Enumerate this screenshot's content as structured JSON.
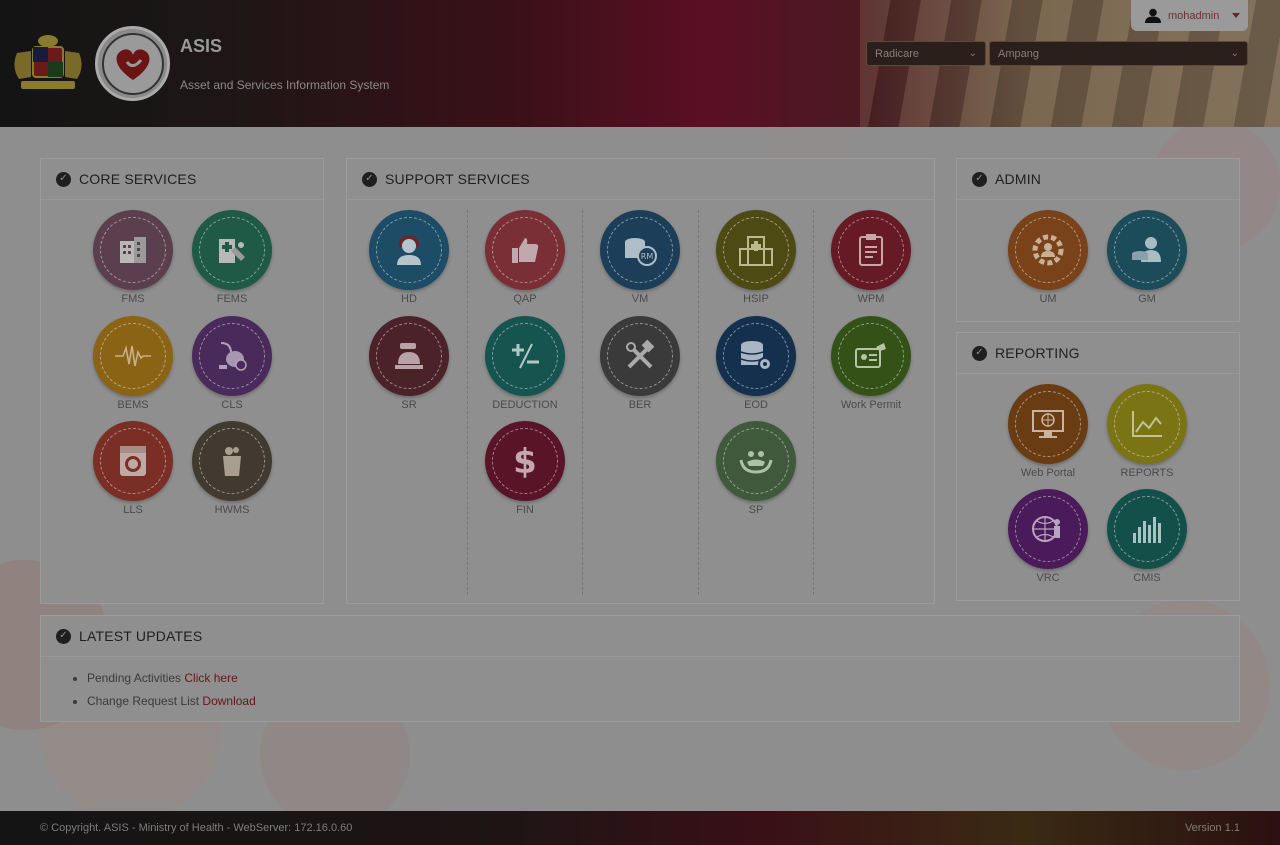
{
  "header": {
    "app_name": "ASIS",
    "app_full_name": "Asset and Services Information System",
    "user": "mohadmin",
    "company_select": "Radicare",
    "hospital_select": "Ampang"
  },
  "sections": {
    "core_title": "CORE SERVICES",
    "support_title": "SUPPORT SERVICES",
    "admin_title": "ADMIN",
    "reporting_title": "REPORTING",
    "updates_title": "LATEST UPDATES"
  },
  "core": [
    {
      "label": "FMS",
      "icon": "building-icon",
      "color": "#5c3f4e"
    },
    {
      "label": "FEMS",
      "icon": "hospital-equipment-icon",
      "color": "#1f5a46"
    },
    {
      "label": "BEMS",
      "icon": "heartbeat-icon",
      "color": "#8a6414"
    },
    {
      "label": "CLS",
      "icon": "vacuum-cleaner-icon",
      "color": "#4a2a5a"
    },
    {
      "label": "LLS",
      "icon": "washing-machine-icon",
      "color": "#7a2e26"
    },
    {
      "label": "HWMS",
      "icon": "waste-bin-icon",
      "color": "#403a30"
    }
  ],
  "support": [
    {
      "label": "HD",
      "icon": "headset-icon",
      "color": "#1c4c66"
    },
    {
      "label": "QAP",
      "icon": "thumbs-up-icon",
      "color": "#7a2e36"
    },
    {
      "label": "VM",
      "icon": "coins-rm-icon",
      "color": "#1c3e58"
    },
    {
      "label": "HSIP",
      "icon": "hospital-icon",
      "color": "#4e4a14"
    },
    {
      "label": "WPM",
      "icon": "clipboard-icon",
      "color": "#661a26"
    },
    {
      "label": "SR",
      "icon": "service-bell-icon",
      "color": "#4a2228"
    },
    {
      "label": "DEDUCTION",
      "icon": "plus-minus-icon",
      "color": "#165450"
    },
    {
      "label": "BER",
      "icon": "tools-icon",
      "color": "#3a3a3a"
    },
    {
      "label": "EOD",
      "icon": "database-gear-icon",
      "color": "#14304e"
    },
    {
      "label": "Work Permit",
      "icon": "id-card-icon",
      "color": "#345218"
    },
    {
      "label": "FIN",
      "icon": "dollar-icon",
      "color": "#5a1428"
    },
    {
      "label": "SP",
      "icon": "hands-care-icon",
      "color": "#3e5a3a"
    }
  ],
  "admin": [
    {
      "label": "UM",
      "icon": "user-gear-icon",
      "color": "#7a4218"
    },
    {
      "label": "GM",
      "icon": "user-group-icon",
      "color": "#1c4c5a"
    }
  ],
  "reporting": [
    {
      "label": "Web Portal",
      "icon": "monitor-globe-icon",
      "color": "#6a3c14"
    },
    {
      "label": "REPORTS",
      "icon": "line-chart-icon",
      "color": "#7a7414"
    },
    {
      "label": "VRC",
      "icon": "globe-person-icon",
      "color": "#4a1a5a"
    },
    {
      "label": "CMIS",
      "icon": "bar-chart-icon",
      "color": "#14504a"
    }
  ],
  "updates": {
    "item1_text": "Pending Activities ",
    "item1_link": "Click here",
    "item2_text": "Change Request List ",
    "item2_link": "Download"
  },
  "footer": {
    "copyright": "© Copyright. ASIS - Ministry of Health - WebServer: 172.16.0.60",
    "version": "Version 1.1"
  }
}
